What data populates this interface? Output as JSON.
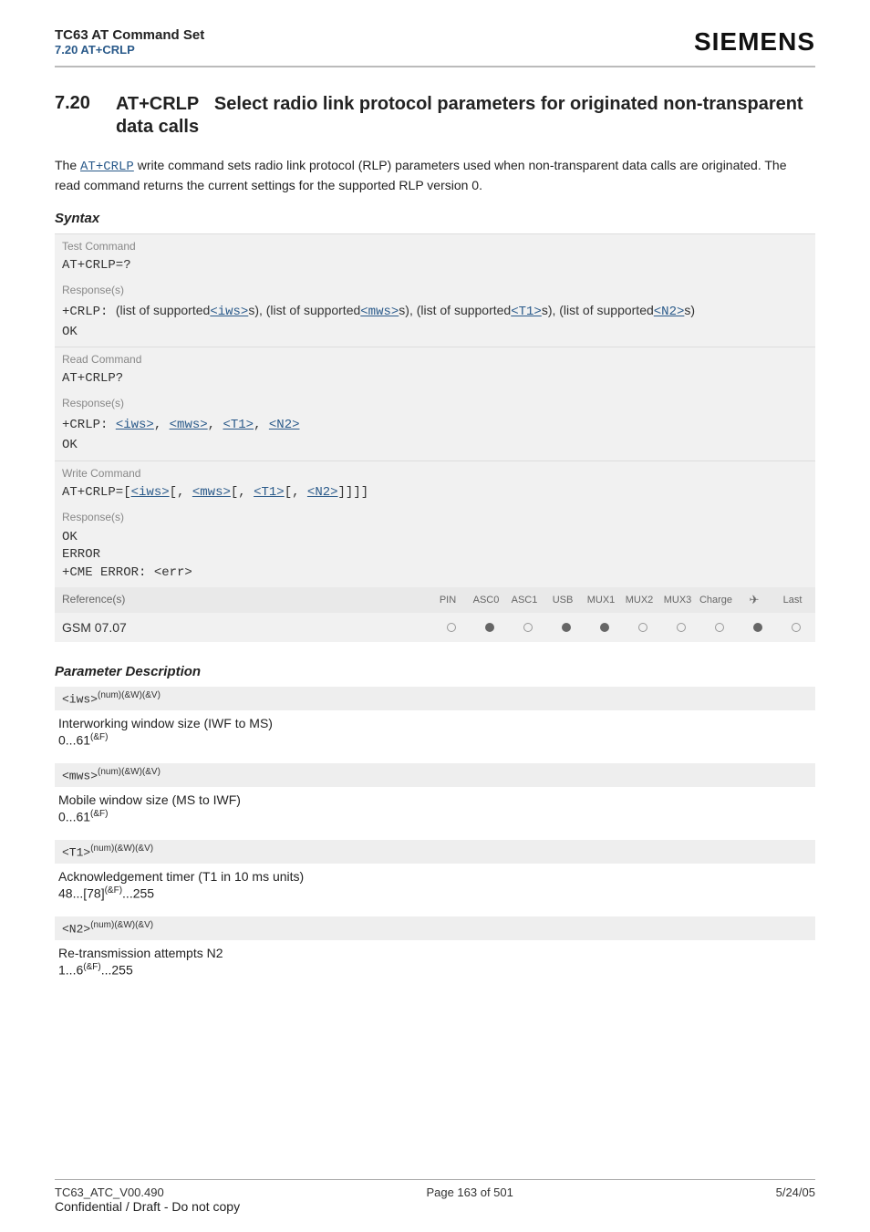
{
  "header": {
    "title": "TC63 AT Command Set",
    "subtitle": "7.20 AT+CRLP",
    "brand": "SIEMENS"
  },
  "section": {
    "number": "7.20",
    "title_cmd": "AT+CRLP",
    "title_rest": "Select radio link protocol parameters for originated non-transparent data calls"
  },
  "intro": {
    "p1a": "The ",
    "link": "AT+CRLP",
    "p1b": " write command sets radio link protocol (RLP) parameters used when non-transparent data calls are originated. The read command returns the current settings for the supported RLP version 0."
  },
  "syntax": {
    "label": "Syntax",
    "test_label": "Test Command",
    "test_cmd": "AT+CRLP=?",
    "resp_label": "Response(s)",
    "test_resp_prefix": "+CRLP: ",
    "test_resp_t1": "(list of supported",
    "iws": "<iws>",
    "test_resp_t2": "s), (list of supported",
    "mws": "<mws>",
    "test_resp_t3": "s), (list of supported",
    "t1": "<T1>",
    "test_resp_t4": "s), (list of supported",
    "n2": "<N2>",
    "test_resp_t5": "s)",
    "ok": "OK",
    "read_label": "Read Command",
    "read_cmd": "AT+CRLP?",
    "read_resp_prefix": "+CRLP: ",
    "comma": ", ",
    "write_label": "Write Command",
    "write_cmd_prefix": "AT+CRLP=",
    "lb": "[",
    "rb": "]",
    "rbclose": "]]]]",
    "error": "ERROR",
    "cme": "+CME ERROR: <err>",
    "ref_label": "Reference(s)",
    "ref_value": "GSM 07.07",
    "cols": {
      "c0": "PIN",
      "c1": "ASC0",
      "c2": "ASC1",
      "c3": "USB",
      "c4": "MUX1",
      "c5": "MUX2",
      "c6": "MUX3",
      "c7": "Charge",
      "c8": "✈",
      "c9": "Last"
    }
  },
  "params": {
    "heading": "Parameter Description",
    "sup_attrs": "(num)(&W)(&V)",
    "iws": {
      "name": "<iws>",
      "desc": "Interworking window size (IWF to MS)",
      "range_a": "0...61",
      "range_sup": "(&F)"
    },
    "mws": {
      "name": "<mws>",
      "desc": "Mobile window size (MS to IWF)",
      "range_a": "0...61",
      "range_sup": "(&F)"
    },
    "t1": {
      "name": "<T1>",
      "desc": "Acknowledgement timer (T1 in 10 ms units)",
      "range_a": "48...[78]",
      "range_sup": "(&F)",
      "range_b": "...255"
    },
    "n2": {
      "name": "<N2>",
      "desc": "Re-transmission attempts N2",
      "range_a": "1...6",
      "range_sup": "(&F)",
      "range_b": "...255"
    }
  },
  "footer": {
    "left": "TC63_ATC_V00.490",
    "center": "Page 163 of 501",
    "right": "5/24/05",
    "conf": "Confidential / Draft - Do not copy"
  }
}
